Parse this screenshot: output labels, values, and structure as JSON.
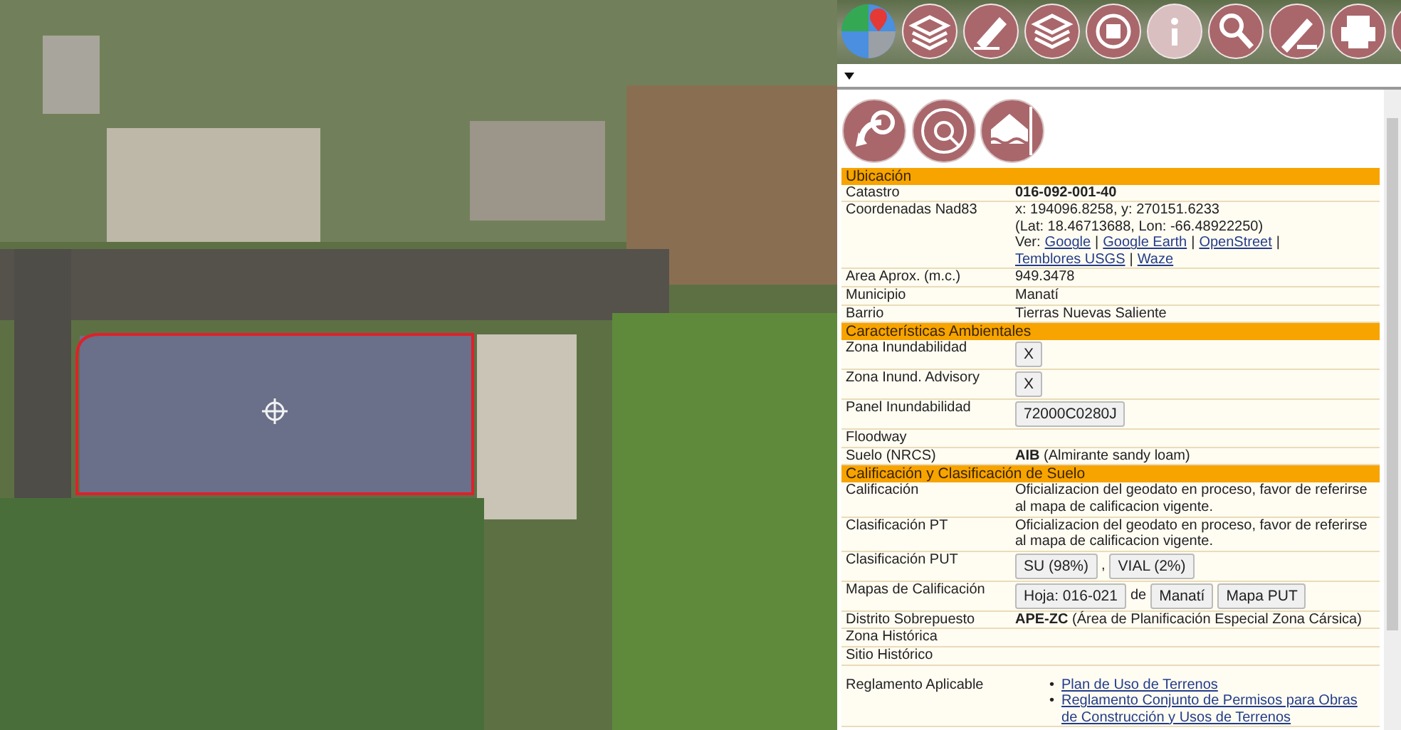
{
  "sections": [
    {
      "title": "Ubicación",
      "rows": [
        {
          "kind": "lines",
          "label": "Catastro",
          "lines": [
            [
              {
                "kind": "bold",
                "text": "016-092-001-40"
              }
            ]
          ]
        },
        {
          "kind": "lines",
          "label": "Coordenadas Nad83",
          "lines": [
            [
              {
                "kind": "text",
                "text": "x: 194096.8258, y: 270151.6233"
              }
            ],
            [
              {
                "kind": "text",
                "text": "(Lat: 18.46713688, Lon: -66.48922250)"
              }
            ],
            [
              {
                "kind": "text",
                "text": "Ver:"
              },
              {
                "kind": "link",
                "text": "Google"
              },
              {
                "kind": "sep",
                "text": "|"
              },
              {
                "kind": "link",
                "text": "Google Earth"
              },
              {
                "kind": "sep",
                "text": "|"
              },
              {
                "kind": "link",
                "text": "OpenStreet"
              },
              {
                "kind": "sep",
                "text": "|"
              },
              {
                "kind": "link",
                "text": "Temblores USGS"
              },
              {
                "kind": "sep",
                "text": "|"
              },
              {
                "kind": "link",
                "text": "Waze"
              }
            ]
          ]
        },
        {
          "kind": "lines",
          "label": "Area Aprox. (m.c.)",
          "lines": [
            [
              {
                "kind": "text",
                "text": "949.3478"
              }
            ]
          ]
        },
        {
          "kind": "lines",
          "label": "Municipio",
          "lines": [
            [
              {
                "kind": "text",
                "text": "Manatí"
              }
            ]
          ]
        },
        {
          "kind": "lines",
          "label": "Barrio",
          "lines": [
            [
              {
                "kind": "text",
                "text": "Tierras Nuevas Saliente"
              }
            ]
          ]
        }
      ]
    },
    {
      "title": "Características Ambientales",
      "rows": [
        {
          "kind": "lines",
          "label": "Zona Inundabilidad",
          "lines": [
            [
              {
                "kind": "button",
                "text": "X"
              }
            ]
          ]
        },
        {
          "kind": "lines",
          "label": "Zona Inund. Advisory",
          "lines": [
            [
              {
                "kind": "button",
                "text": "X"
              }
            ]
          ]
        },
        {
          "kind": "lines",
          "label": "Panel Inundabilidad",
          "lines": [
            [
              {
                "kind": "button",
                "text": "72000C0280J"
              }
            ]
          ]
        },
        {
          "kind": "lines",
          "label": "Floodway",
          "lines": []
        },
        {
          "kind": "lines",
          "label": "Suelo (NRCS)",
          "lines": [
            [
              {
                "kind": "rich",
                "text": "**AIB** (Almirante sandy loam)"
              }
            ]
          ]
        }
      ]
    },
    {
      "title": "Calificación y Clasificación de Suelo",
      "rows": [
        {
          "kind": "lines",
          "label": "Calificación",
          "lines": [
            [
              {
                "kind": "text",
                "text": "Oficializacion del geodato en proceso, favor de referirse al mapa de calificacion vigente."
              }
            ]
          ]
        },
        {
          "kind": "lines",
          "label": "Clasificación PT",
          "lines": [
            [
              {
                "kind": "text",
                "text": "Oficializacion del geodato en proceso, favor de referirse al mapa de calificacion vigente."
              }
            ]
          ]
        },
        {
          "kind": "lines",
          "label": "Clasificación PUT",
          "lines": [
            [
              {
                "kind": "button",
                "text": "SU (98%)"
              },
              {
                "kind": "sep",
                "text": ","
              },
              {
                "kind": "button",
                "text": "VIAL (2%)"
              }
            ]
          ]
        },
        {
          "kind": "lines",
          "label": "Mapas de Calificación",
          "lines": [
            [
              {
                "kind": "button",
                "text": "Hoja: 016-021"
              },
              {
                "kind": "sep",
                "text": "de"
              },
              {
                "kind": "button",
                "text": "Manatí"
              },
              {
                "kind": "button",
                "text": "Mapa PUT"
              }
            ]
          ]
        },
        {
          "kind": "lines",
          "label": "Distrito Sobrepuesto",
          "lines": [
            [
              {
                "kind": "rich",
                "text": "**APE-ZC** (Área de Planificación Especial Zona Cársica)"
              }
            ]
          ]
        },
        {
          "kind": "lines",
          "label": "Zona Histórica",
          "lines": []
        },
        {
          "kind": "lines",
          "label": "Sitio Histórico",
          "lines": []
        },
        {
          "kind": "list",
          "label": "Reglamento Aplicable",
          "items": [
            {
              "bullet": "•",
              "text": "Plan de Uso de Terrenos"
            },
            {
              "bullet": "•",
              "text": "Reglamento Conjunto de Permisos para Obras de Construcción y Usos de Terrenos"
            }
          ]
        }
      ]
    }
  ]
}
